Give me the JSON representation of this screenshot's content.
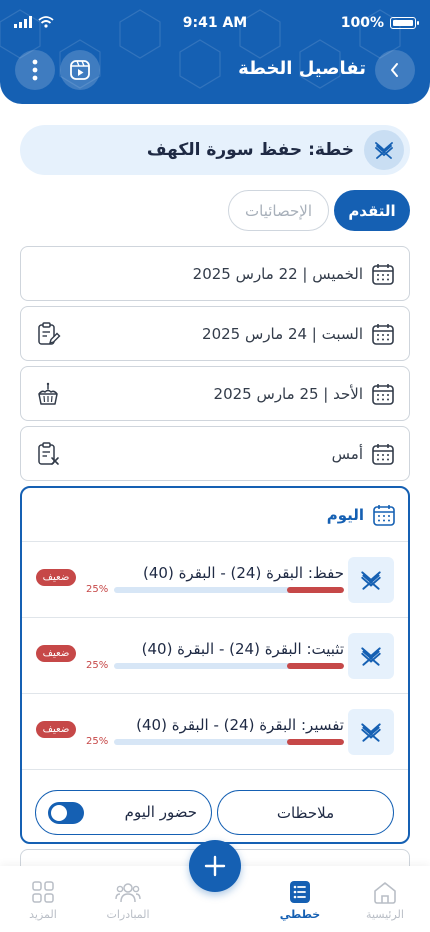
{
  "status_bar": {
    "time": "9:41 AM",
    "battery": "100%"
  },
  "header": {
    "title": "تفاصيل الخطة"
  },
  "plan": {
    "label": "خطة: حفظ سورة الكهف"
  },
  "tabs": {
    "active": "التقدم",
    "inactive": "الإحصائيات"
  },
  "days": [
    {
      "label": "الخميس | 22 مارس 2025"
    },
    {
      "label": "السبت | 24 مارس 2025"
    },
    {
      "label": "الأحد | 25 مارس 2025"
    },
    {
      "label": "أمس"
    }
  ],
  "today": {
    "label": "اليوم",
    "tasks": [
      {
        "title": "حفظ: البقرة (24) - البقرة (40)",
        "percent": "25%",
        "progress": 0.25,
        "badge": "ضعيف"
      },
      {
        "title": "تثبيت: البقرة (24) - البقرة (40)",
        "percent": "25%",
        "progress": 0.25,
        "badge": "ضعيف"
      },
      {
        "title": "تفسير: البقرة (24) - البقرة (40)",
        "percent": "25%",
        "progress": 0.25,
        "badge": "ضعيف"
      }
    ],
    "notes_label": "ملاحظات",
    "attendance_label": "حضور اليوم"
  },
  "nav": {
    "home": "الرئيسية",
    "plans": "خططي",
    "initiatives": "المبادرات",
    "more": "المزيد"
  },
  "colors": {
    "primary": "#1560b3",
    "weak": "#c64848",
    "light": "#e6f1fc"
  }
}
